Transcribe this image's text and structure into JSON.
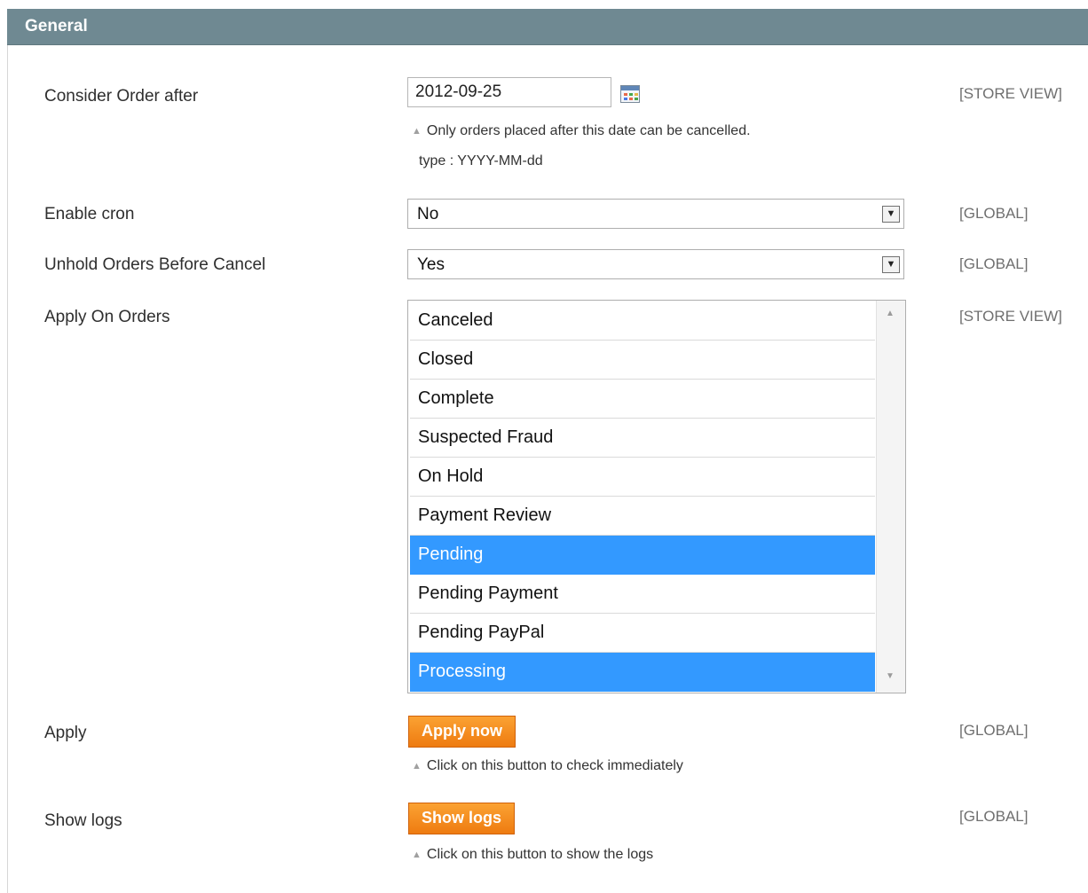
{
  "section": {
    "title": "General"
  },
  "fields": {
    "consider_order": {
      "label": "Consider Order after",
      "value": "2012-09-25",
      "note1": "Only orders placed after this date can be cancelled.",
      "note2": "type : YYYY-MM-dd",
      "scope": "[STORE VIEW]"
    },
    "enable_cron": {
      "label": "Enable cron",
      "value": "No",
      "scope": "[GLOBAL]"
    },
    "unhold_orders": {
      "label": "Unhold Orders Before Cancel",
      "value": "Yes",
      "scope": "[GLOBAL]"
    },
    "apply_on_orders": {
      "label": "Apply On Orders",
      "scope": "[STORE VIEW]",
      "options": [
        {
          "label": "Canceled",
          "selected": false
        },
        {
          "label": "Closed",
          "selected": false
        },
        {
          "label": "Complete",
          "selected": false
        },
        {
          "label": "Suspected Fraud",
          "selected": false
        },
        {
          "label": "On Hold",
          "selected": false
        },
        {
          "label": "Payment Review",
          "selected": false
        },
        {
          "label": "Pending",
          "selected": true
        },
        {
          "label": "Pending Payment",
          "selected": false
        },
        {
          "label": "Pending PayPal",
          "selected": false
        },
        {
          "label": "Processing",
          "selected": true
        }
      ]
    },
    "apply": {
      "label": "Apply",
      "button": "Apply now",
      "note": "Click on this button to check immediately",
      "scope": "[GLOBAL]"
    },
    "show_logs": {
      "label": "Show logs",
      "button": "Show logs",
      "note": "Click on this button to show the logs",
      "scope": "[GLOBAL]"
    }
  },
  "colors": {
    "header_bg": "#6f8992",
    "selected_option_bg": "#3399ff",
    "button_orange": "#f18a1f"
  },
  "icons": {
    "calendar": "calendar-icon",
    "dropdown": "chevron-down-icon",
    "hint": "triangle-up-icon"
  }
}
